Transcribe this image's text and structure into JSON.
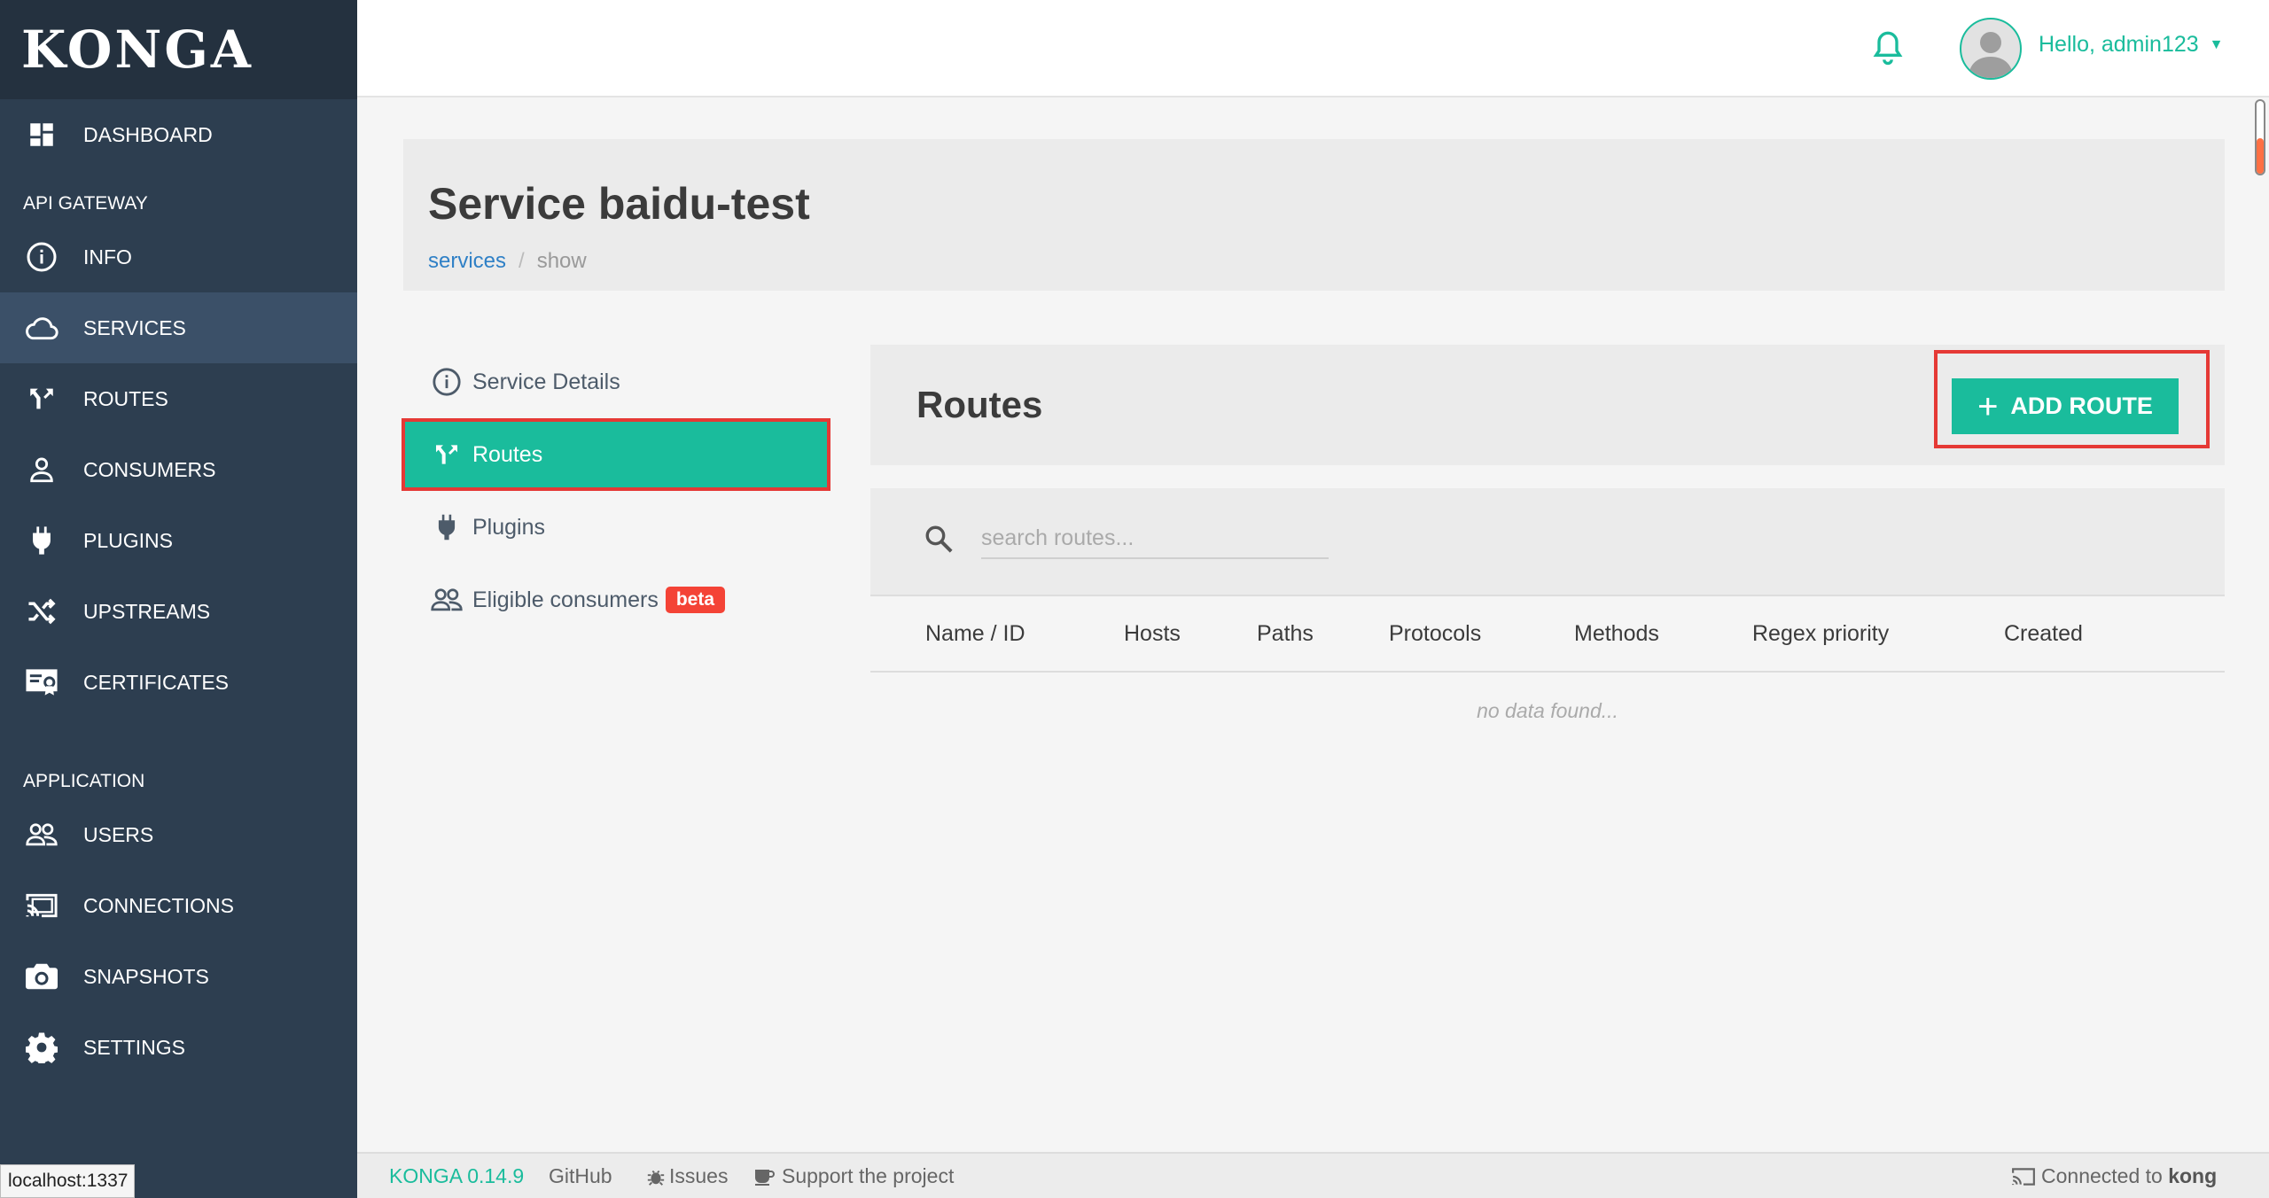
{
  "app": {
    "logo": "KONGA"
  },
  "sidebar": {
    "dashboard": "DASHBOARD",
    "section_api": "API GATEWAY",
    "info": "INFO",
    "services": "SERVICES",
    "routes": "ROUTES",
    "consumers": "CONSUMERS",
    "plugins": "PLUGINS",
    "upstreams": "UPSTREAMS",
    "certificates": "CERTIFICATES",
    "section_app": "APPLICATION",
    "users": "USERS",
    "connections": "CONNECTIONS",
    "snapshots": "SNAPSHOTS",
    "settings": "SETTINGS"
  },
  "topbar": {
    "greeting": "Hello, admin123"
  },
  "page": {
    "title": "Service baidu-test",
    "breadcrumb": {
      "parent": "services",
      "current": "show"
    }
  },
  "subnav": {
    "service_details": "Service Details",
    "routes": "Routes",
    "plugins": "Plugins",
    "eligible_consumers": "Eligible consumers",
    "beta_badge": "beta"
  },
  "routes_panel": {
    "title": "Routes",
    "add_button": "ADD ROUTE",
    "search_placeholder": "search routes...",
    "columns": [
      "Name / ID",
      "Hosts",
      "Paths",
      "Protocols",
      "Methods",
      "Regex priority",
      "Created"
    ],
    "empty_text": "no data found..."
  },
  "footer": {
    "version": "KONGA 0.14.9",
    "github": "GitHub",
    "issues": "Issues",
    "support": "Support the project",
    "connected_prefix": "Connected to",
    "connected_target": "kong"
  },
  "status_bar": {
    "url": "localhost:1337"
  },
  "colors": {
    "accent": "#1abc9c",
    "sidebar": "#2d3e50",
    "highlight": "#e53935",
    "beta": "#f44336"
  }
}
